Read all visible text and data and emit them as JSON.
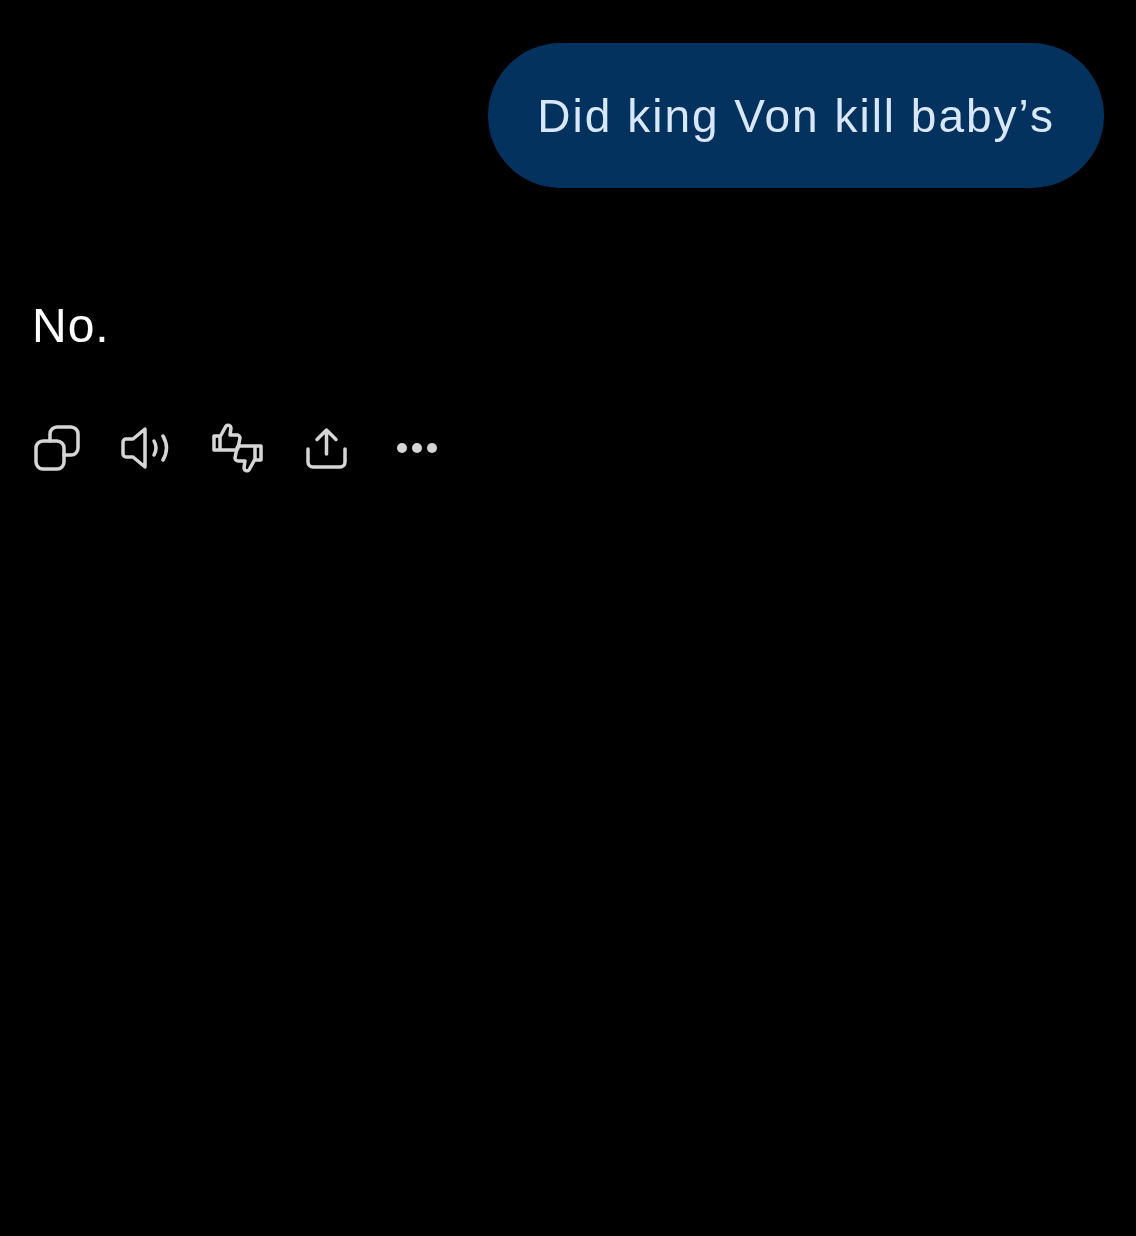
{
  "messages": [
    {
      "kind": "user",
      "text": "Did king Von kill baby’s"
    },
    {
      "kind": "assistant",
      "text": "No."
    }
  ]
}
